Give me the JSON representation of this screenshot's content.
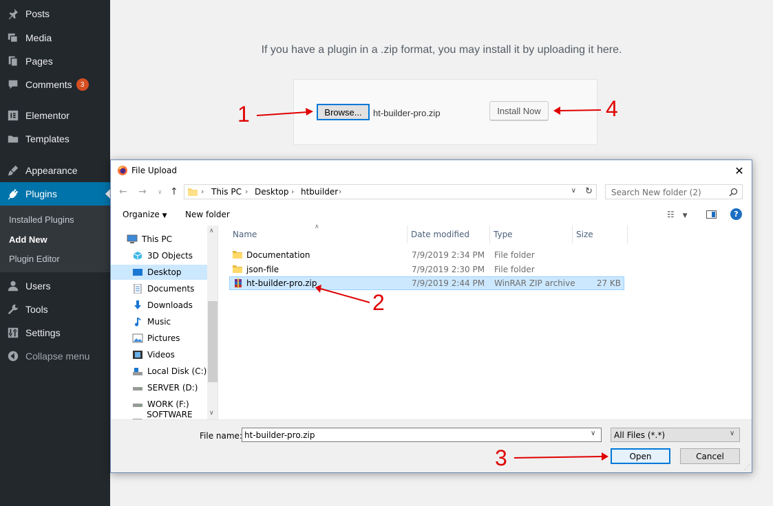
{
  "sidebar": {
    "items": [
      {
        "label": "Posts",
        "icon": "pushpin-icon"
      },
      {
        "label": "Media",
        "icon": "media-icon"
      },
      {
        "label": "Pages",
        "icon": "pages-icon"
      },
      {
        "label": "Comments",
        "icon": "comment-icon",
        "badge": "3"
      },
      {
        "label": "Elementor",
        "icon": "elementor-icon"
      },
      {
        "label": "Templates",
        "icon": "folder-icon"
      },
      {
        "label": "Appearance",
        "icon": "paintbrush-icon"
      },
      {
        "label": "Plugins",
        "icon": "plugin-icon"
      },
      {
        "label": "Users",
        "icon": "user-icon"
      },
      {
        "label": "Tools",
        "icon": "wrench-icon"
      },
      {
        "label": "Settings",
        "icon": "settings-icon"
      },
      {
        "label": "Collapse menu",
        "icon": "collapse-icon"
      }
    ],
    "submenu": [
      "Installed Plugins",
      "Add New",
      "Plugin Editor"
    ],
    "active_color": "#0073aa",
    "background": "#23282d"
  },
  "upload": {
    "help_text": "If you have a plugin in a .zip format, you may install it by uploading it here.",
    "browse_label": "Browse...",
    "chosen_file": "ht-builder-pro.zip",
    "install_label": "Install Now"
  },
  "annotations": {
    "n1": "1",
    "n2": "2",
    "n3": "3",
    "n4": "4",
    "color": "#e00000"
  },
  "dialog": {
    "title": "File Upload",
    "breadcrumb": [
      "This PC",
      "Desktop",
      "htbuilder"
    ],
    "search_placeholder": "Search New folder (2)",
    "organize_label": "Organize",
    "new_folder_label": "New folder",
    "nav_items": [
      {
        "label": "This PC",
        "icon": "computer-icon"
      },
      {
        "label": "3D Objects",
        "icon": "3d-objects-icon"
      },
      {
        "label": "Desktop",
        "icon": "desktop-icon"
      },
      {
        "label": "Documents",
        "icon": "documents-icon"
      },
      {
        "label": "Downloads",
        "icon": "downloads-icon"
      },
      {
        "label": "Music",
        "icon": "music-icon"
      },
      {
        "label": "Pictures",
        "icon": "pictures-icon"
      },
      {
        "label": "Videos",
        "icon": "videos-icon"
      },
      {
        "label": "Local Disk (C:)",
        "icon": "drive-icon"
      },
      {
        "label": "SERVER (D:)",
        "icon": "drive-icon"
      },
      {
        "label": "WORK (F:)",
        "icon": "drive-icon"
      },
      {
        "label": "SOFTWARE (G:)",
        "icon": "drive-icon"
      }
    ],
    "columns": [
      "Name",
      "Date modified",
      "Type",
      "Size"
    ],
    "files": [
      {
        "name": "Documentation",
        "date": "7/9/2019 2:34 PM",
        "type": "File folder",
        "size": "",
        "icon": "folder-icon"
      },
      {
        "name": "json-file",
        "date": "7/9/2019 2:30 PM",
        "type": "File folder",
        "size": "",
        "icon": "folder-icon"
      },
      {
        "name": "ht-builder-pro.zip",
        "date": "7/9/2019 2:44 PM",
        "type": "WinRAR ZIP archive",
        "size": "27 KB",
        "icon": "winrar-archive-icon"
      }
    ],
    "file_name_label": "File name:",
    "file_name_value": "ht-builder-pro.zip",
    "file_type": "All Files (*.*)",
    "open_label": "Open",
    "cancel_label": "Cancel",
    "selection_color": "#cce8ff"
  }
}
